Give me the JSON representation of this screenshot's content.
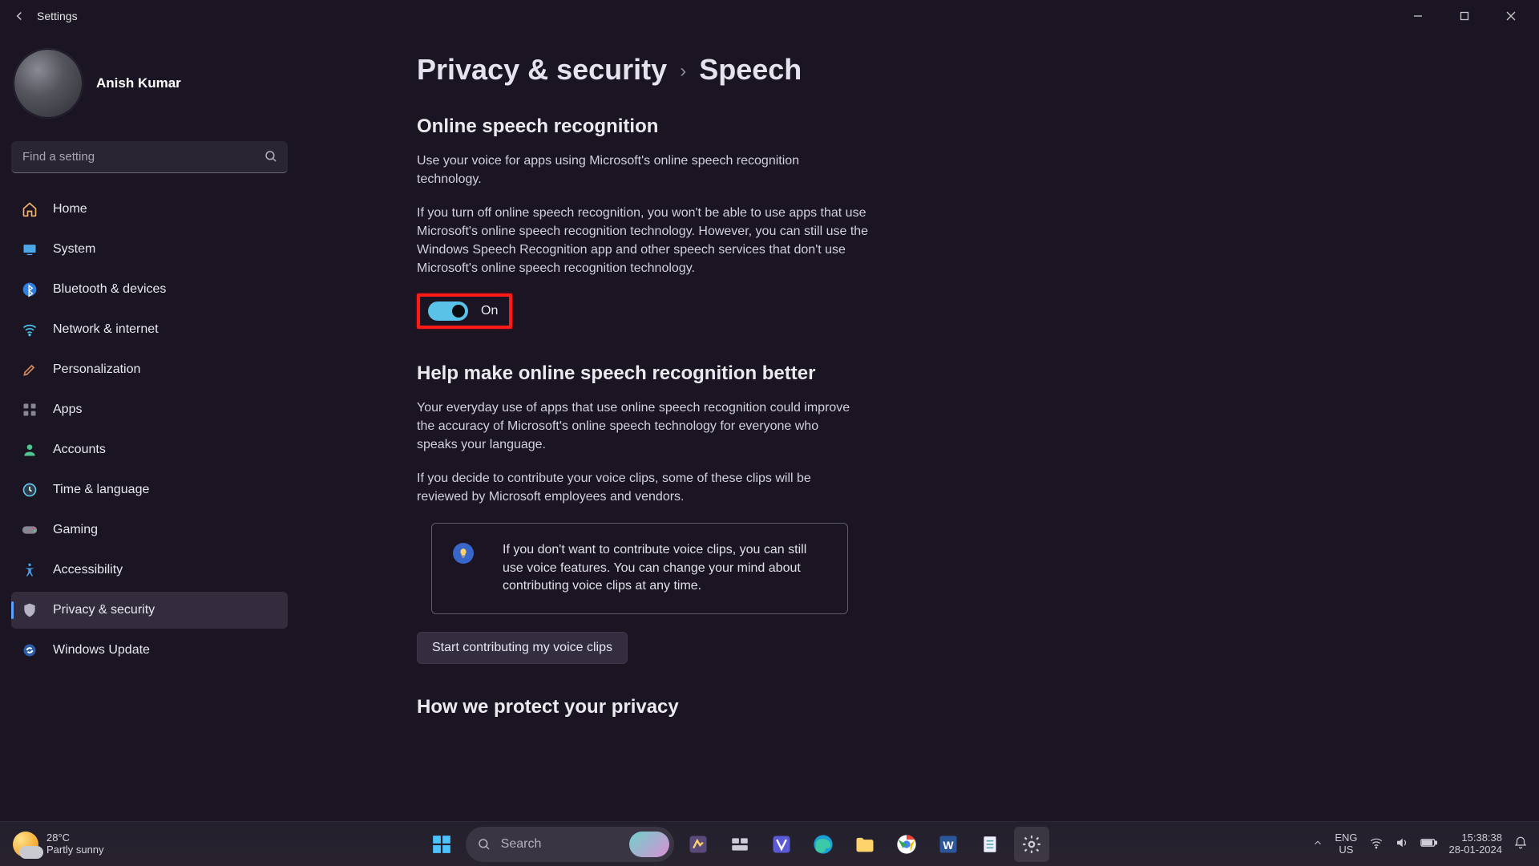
{
  "titlebar": {
    "title": "Settings"
  },
  "profile": {
    "name": "Anish Kumar"
  },
  "search": {
    "placeholder": "Find a setting"
  },
  "nav": [
    {
      "label": "Home",
      "active": false
    },
    {
      "label": "System",
      "active": false
    },
    {
      "label": "Bluetooth & devices",
      "active": false
    },
    {
      "label": "Network & internet",
      "active": false
    },
    {
      "label": "Personalization",
      "active": false
    },
    {
      "label": "Apps",
      "active": false
    },
    {
      "label": "Accounts",
      "active": false
    },
    {
      "label": "Time & language",
      "active": false
    },
    {
      "label": "Gaming",
      "active": false
    },
    {
      "label": "Accessibility",
      "active": false
    },
    {
      "label": "Privacy & security",
      "active": true
    },
    {
      "label": "Windows Update",
      "active": false
    }
  ],
  "breadcrumb": {
    "parent": "Privacy & security",
    "current": "Speech"
  },
  "speech": {
    "section1_title": "Online speech recognition",
    "section1_p1": "Use your voice for apps using Microsoft's online speech recognition technology.",
    "section1_p2": "If you turn off online speech recognition, you won't be able to use apps that use Microsoft's online speech recognition technology.  However, you can still use the Windows Speech Recognition app and other speech services that don't use Microsoft's online speech recognition technology.",
    "toggle_label": "On",
    "section2_title": "Help make online speech recognition better",
    "section2_p1": "Your everyday use of apps that use online speech recognition could improve the accuracy of Microsoft's online speech technology for everyone who speaks your language.",
    "section2_p2": "If you decide to contribute your voice clips, some of these clips will be reviewed by Microsoft employees and vendors.",
    "info_card": "If you don't want to contribute voice clips, you can still use voice features.  You can change your mind about contributing voice clips at any time.",
    "contribute_btn": "Start contributing my voice clips",
    "section3_title": "How we protect your privacy"
  },
  "taskbar": {
    "weather_temp": "28°C",
    "weather_desc": "Partly sunny",
    "search_placeholder": "Search",
    "lang_top": "ENG",
    "lang_bot": "US",
    "time": "15:38:38",
    "date": "28-01-2024"
  }
}
